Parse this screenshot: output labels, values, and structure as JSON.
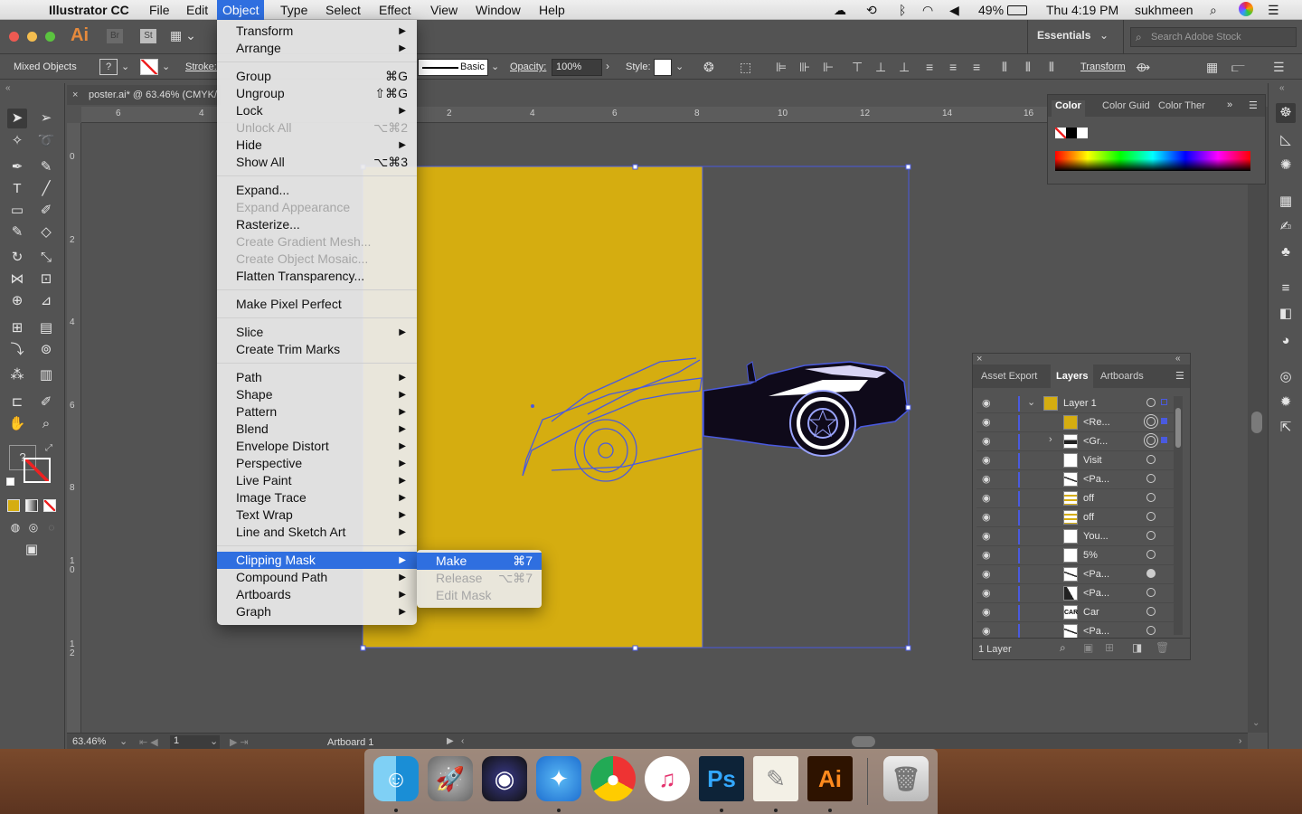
{
  "menubar": {
    "app_name": "Illustrator CC",
    "items": [
      "File",
      "Edit",
      "Object",
      "Type",
      "Select",
      "Effect",
      "View",
      "Window",
      "Help"
    ],
    "battery": "49%",
    "clock": "Thu 4:19 PM",
    "user": "sukhmeen"
  },
  "appbar": {
    "logo": "Ai",
    "br": "Br",
    "st": "St",
    "workspace": "Essentials",
    "search_placeholder": "Search Adobe Stock"
  },
  "control_bar": {
    "selection": "Mixed Objects",
    "stroke_label": "Stroke:",
    "brush": "Basic",
    "opacity_label": "Opacity:",
    "opacity_value": "100%",
    "style_label": "Style:",
    "transform_label": "Transform"
  },
  "document": {
    "tab_title": "poster.ai* @ 63.46% (CMYK/",
    "zoom": "63.46%",
    "artboard_number": "1",
    "artboard_name": "Artboard 1",
    "ruler_h": [
      "6",
      "4",
      "2",
      "4",
      "6",
      "8",
      "10",
      "12",
      "14",
      "16"
    ],
    "ruler_v": [
      "0",
      "2",
      "4",
      "6",
      "8",
      "1 0",
      "1 2"
    ]
  },
  "object_menu": {
    "items": [
      {
        "label": "Transform",
        "shortcut": "",
        "submenu": true,
        "disabled": false
      },
      {
        "label": "Arrange",
        "shortcut": "",
        "submenu": true,
        "disabled": false
      },
      {
        "sep": true
      },
      {
        "label": "Group",
        "shortcut": "⌘G",
        "submenu": false,
        "disabled": false
      },
      {
        "label": "Ungroup",
        "shortcut": "⇧⌘G",
        "submenu": false,
        "disabled": false
      },
      {
        "label": "Lock",
        "shortcut": "",
        "submenu": true,
        "disabled": false
      },
      {
        "label": "Unlock All",
        "shortcut": "⌥⌘2",
        "submenu": false,
        "disabled": true
      },
      {
        "label": "Hide",
        "shortcut": "",
        "submenu": true,
        "disabled": false
      },
      {
        "label": "Show All",
        "shortcut": "⌥⌘3",
        "submenu": false,
        "disabled": false
      },
      {
        "sep": true
      },
      {
        "label": "Expand...",
        "shortcut": "",
        "submenu": false,
        "disabled": false
      },
      {
        "label": "Expand Appearance",
        "shortcut": "",
        "submenu": false,
        "disabled": true
      },
      {
        "label": "Rasterize...",
        "shortcut": "",
        "submenu": false,
        "disabled": false
      },
      {
        "label": "Create Gradient Mesh...",
        "shortcut": "",
        "submenu": false,
        "disabled": true
      },
      {
        "label": "Create Object Mosaic...",
        "shortcut": "",
        "submenu": false,
        "disabled": true
      },
      {
        "label": "Flatten Transparency...",
        "shortcut": "",
        "submenu": false,
        "disabled": false
      },
      {
        "sep": true
      },
      {
        "label": "Make Pixel Perfect",
        "shortcut": "",
        "submenu": false,
        "disabled": false
      },
      {
        "sep": true
      },
      {
        "label": "Slice",
        "shortcut": "",
        "submenu": true,
        "disabled": false
      },
      {
        "label": "Create Trim Marks",
        "shortcut": "",
        "submenu": false,
        "disabled": false
      },
      {
        "sep": true
      },
      {
        "label": "Path",
        "shortcut": "",
        "submenu": true,
        "disabled": false
      },
      {
        "label": "Shape",
        "shortcut": "",
        "submenu": true,
        "disabled": false
      },
      {
        "label": "Pattern",
        "shortcut": "",
        "submenu": true,
        "disabled": false
      },
      {
        "label": "Blend",
        "shortcut": "",
        "submenu": true,
        "disabled": false
      },
      {
        "label": "Envelope Distort",
        "shortcut": "",
        "submenu": true,
        "disabled": false
      },
      {
        "label": "Perspective",
        "shortcut": "",
        "submenu": true,
        "disabled": false
      },
      {
        "label": "Live Paint",
        "shortcut": "",
        "submenu": true,
        "disabled": false
      },
      {
        "label": "Image Trace",
        "shortcut": "",
        "submenu": true,
        "disabled": false
      },
      {
        "label": "Text Wrap",
        "shortcut": "",
        "submenu": true,
        "disabled": false
      },
      {
        "label": "Line and Sketch Art",
        "shortcut": "",
        "submenu": true,
        "disabled": false
      },
      {
        "sep": true
      },
      {
        "label": "Clipping Mask",
        "shortcut": "",
        "submenu": true,
        "disabled": false,
        "highlighted": true
      },
      {
        "label": "Compound Path",
        "shortcut": "",
        "submenu": true,
        "disabled": false
      },
      {
        "label": "Artboards",
        "shortcut": "",
        "submenu": true,
        "disabled": false
      },
      {
        "label": "Graph",
        "shortcut": "",
        "submenu": true,
        "disabled": false
      }
    ]
  },
  "clipping_submenu": {
    "items": [
      {
        "label": "Make",
        "shortcut": "⌘7",
        "disabled": false,
        "highlighted": true
      },
      {
        "label": "Release",
        "shortcut": "⌥⌘7",
        "disabled": true
      },
      {
        "label": "Edit Mask",
        "shortcut": "",
        "disabled": true
      }
    ]
  },
  "color_panel": {
    "tabs": [
      "Color",
      "Color Guid",
      "Color Ther"
    ]
  },
  "layers_panel": {
    "tabs": [
      "Asset Export",
      "Layers",
      "Artboards"
    ],
    "rows": [
      "Layer 1",
      "<Re...",
      "<Gr...",
      "Visit",
      "<Pa...",
      "off",
      "off",
      "You...",
      "5%",
      "<Pa...",
      "<Pa...",
      "Car",
      "<Pa..."
    ],
    "thumb_texts": [
      "CAR"
    ],
    "footer": "1 Layer"
  },
  "colors": {
    "artboard_fill": "#d5ad10",
    "selection": "#4a5adf",
    "menu_highlight": "#2f6fe0",
    "car_body": "#0f0a1a"
  }
}
